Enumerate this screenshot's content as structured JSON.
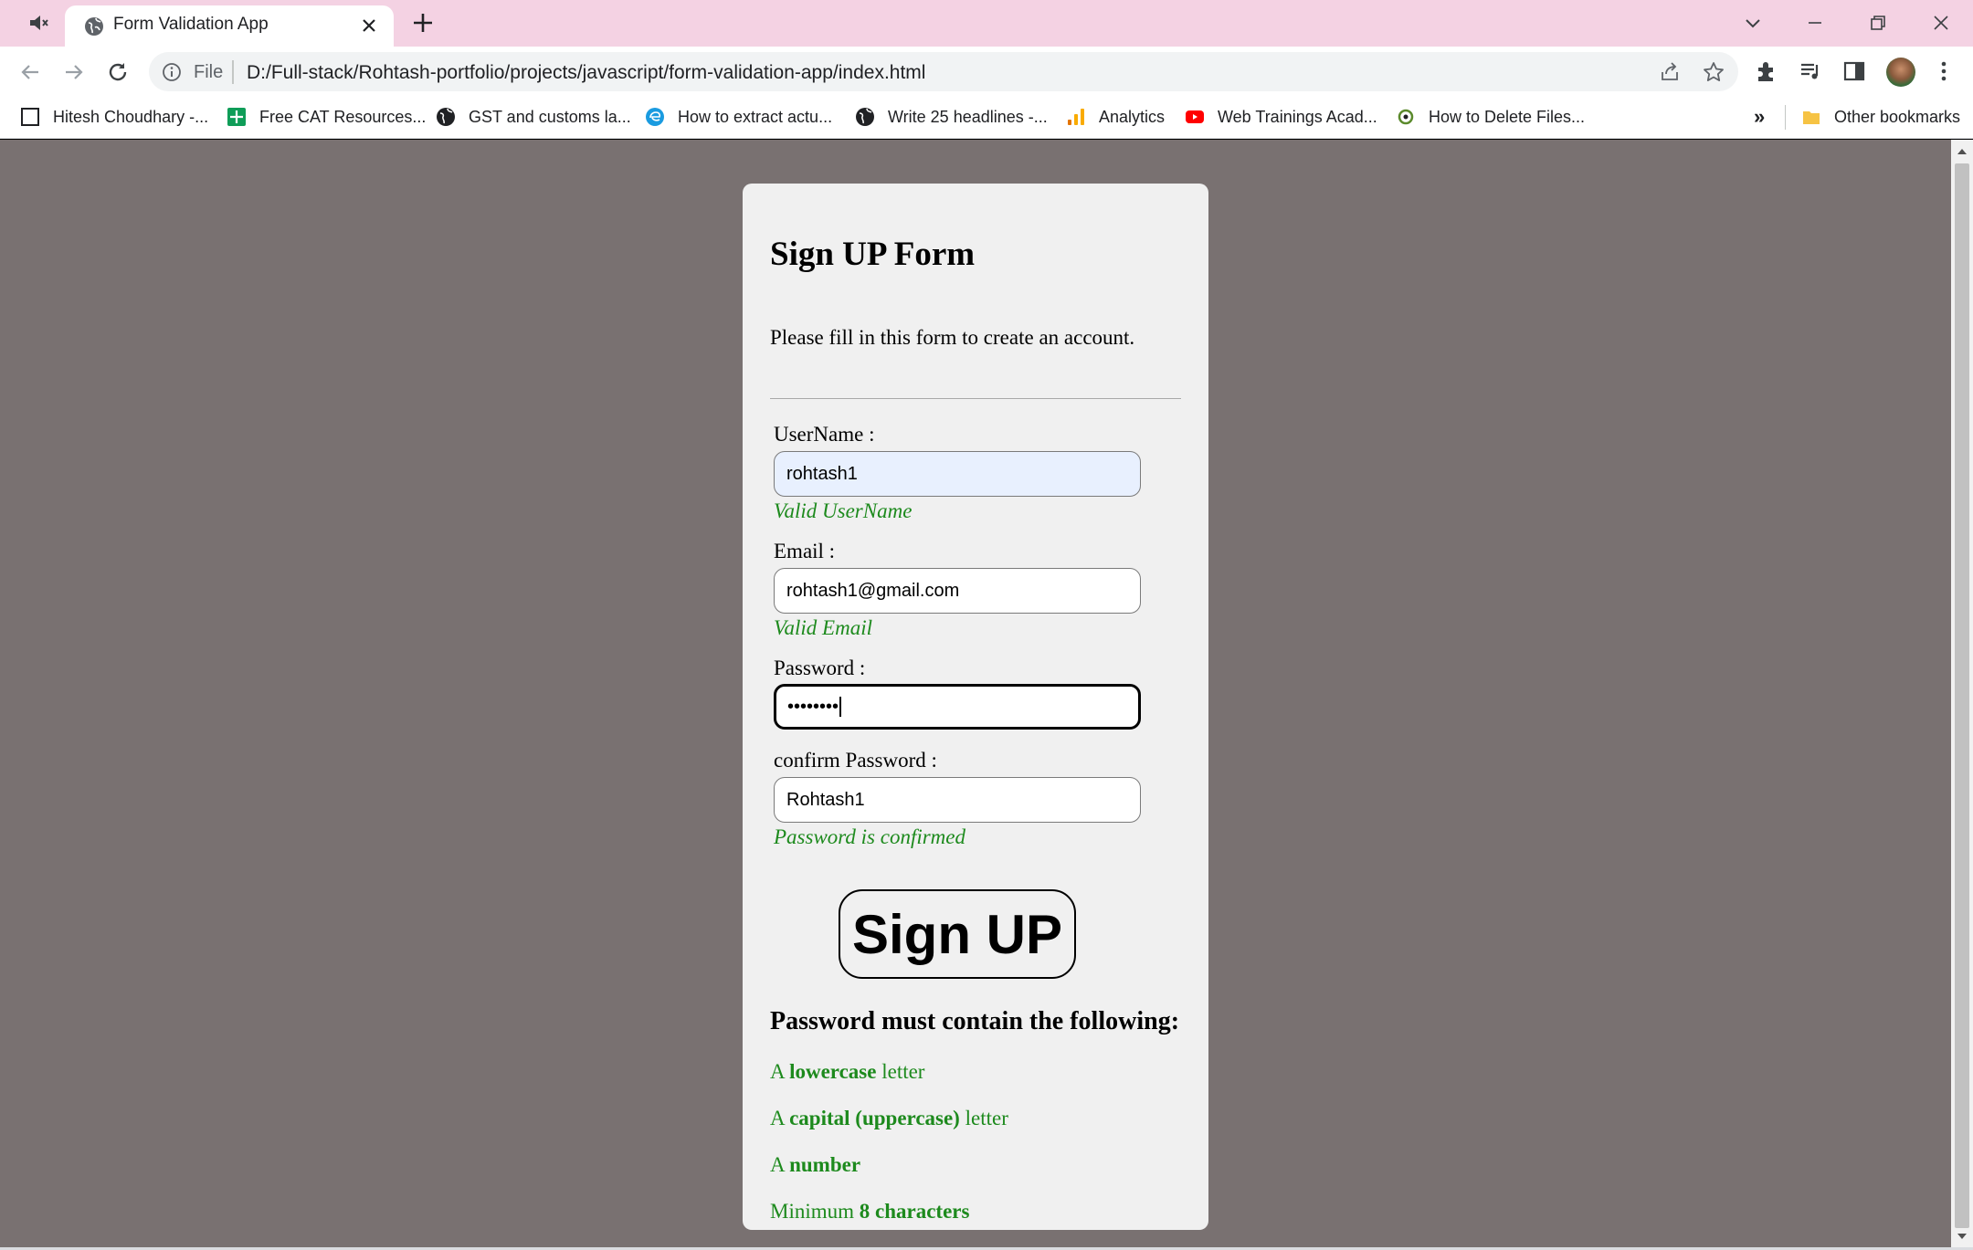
{
  "browser": {
    "tab_title": "Form Validation App",
    "url_scheme_label": "File",
    "url": "D:/Full-stack/Rohtash-portfolio/projects/javascript/form-validation-app/index.html",
    "bookmarks": [
      {
        "label": "Hitesh Choudhary -...",
        "icon": "bookmark-page-icon"
      },
      {
        "label": "Free CAT Resources...",
        "icon": "sheets-icon"
      },
      {
        "label": "GST and customs la...",
        "icon": "globe-icon"
      },
      {
        "label": "How to extract actu...",
        "icon": "edge-icon"
      },
      {
        "label": "Write 25 headlines -...",
        "icon": "globe-icon"
      },
      {
        "label": "Analytics",
        "icon": "analytics-icon"
      },
      {
        "label": "Web Trainings Acad...",
        "icon": "youtube-icon"
      },
      {
        "label": "How to Delete Files...",
        "icon": "site-icon"
      }
    ],
    "bookmarks_overflow": "»",
    "other_bookmarks": "Other bookmarks"
  },
  "form": {
    "title": "Sign UP Form",
    "subtitle": "Please fill in this form to create an account.",
    "username": {
      "label": "UserName :",
      "value": "rohtash1",
      "message": "Valid UserName"
    },
    "email": {
      "label": "Email :",
      "value": "rohtash1@gmail.com",
      "message": "Valid Email"
    },
    "password": {
      "label": "Password :",
      "value": "••••••••"
    },
    "confirm": {
      "label": "confirm Password :",
      "value": "Rohtash1",
      "message": "Password is confirmed"
    },
    "submit_label": "Sign UP"
  },
  "requirements": {
    "title": "Password must contain the following:",
    "items": [
      {
        "pre": "A ",
        "bold": "lowercase",
        "post": " letter"
      },
      {
        "pre": "A ",
        "bold": "capital (uppercase)",
        "post": " letter"
      },
      {
        "pre": "A ",
        "bold": "number",
        "post": ""
      },
      {
        "pre": "Minimum ",
        "bold": "8 characters",
        "post": ""
      }
    ]
  },
  "colors": {
    "titlebar": "#f4d2e3",
    "page_background": "#797171",
    "card_background": "#f0f0f0",
    "valid_green": "#1d8a1d"
  }
}
